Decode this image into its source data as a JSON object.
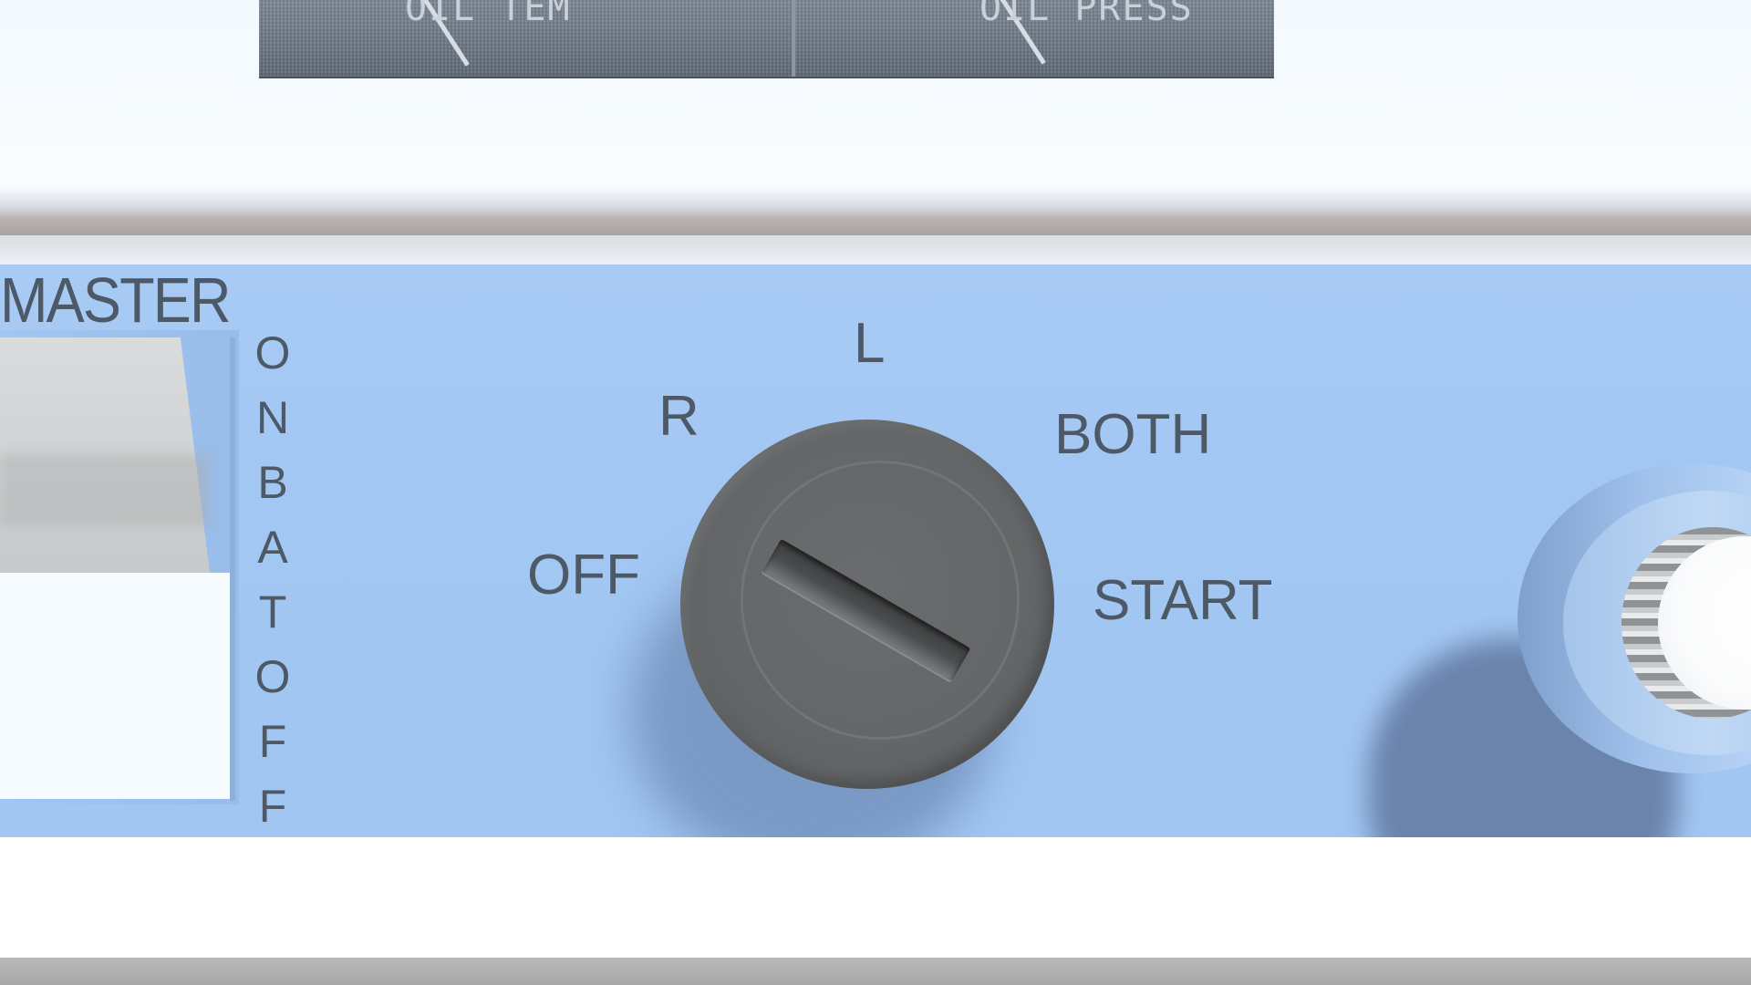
{
  "gauges": {
    "oil_temp_label": "OIL TEMP",
    "oil_press_label": "OIL PRESS"
  },
  "panel": {
    "title": "MASTER",
    "master_switch": {
      "label_letters": [
        "O",
        "N",
        "B",
        "A",
        "T",
        "O",
        "F",
        "F"
      ]
    },
    "magneto_selector": {
      "positions": {
        "off": "OFF",
        "right": "R",
        "left": "L",
        "both": "BOTH",
        "start": "START"
      }
    }
  },
  "colors": {
    "panel_blue": "#a3c7f3",
    "knob_gray": "#646668",
    "label_gray": "#4d5966",
    "background": "#f4fafe"
  }
}
